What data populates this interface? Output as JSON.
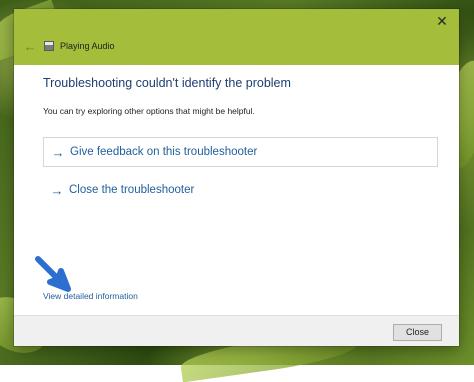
{
  "window": {
    "title": "Playing Audio",
    "back_glyph": "←",
    "close_glyph": "✕",
    "accent_color": "#a4bd3a"
  },
  "main": {
    "heading": "Troubleshooting couldn't identify the problem",
    "subtext": "You can try exploring other options that might be helpful.",
    "options": [
      {
        "arrow": "→",
        "label": "Give feedback on this troubleshooter",
        "icon": "arrow-right-icon"
      },
      {
        "arrow": "→",
        "label": "Close the troubleshooter",
        "icon": "arrow-right-icon"
      }
    ],
    "link_color": "#1f5e9e",
    "detail_link": "View detailed information"
  },
  "footer": {
    "close_label": "Close"
  },
  "annotation": {
    "icon": "blue-pointer-arrow-icon",
    "color": "#2d6fd0"
  }
}
